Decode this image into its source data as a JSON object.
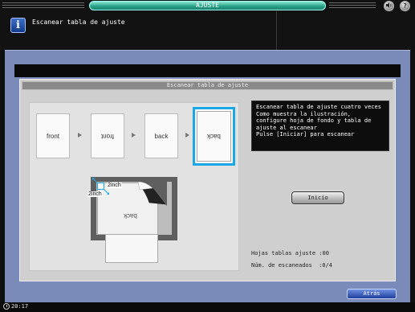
{
  "header": {
    "title": "AJUSTE",
    "speaker_icon": "speaker-icon",
    "help_icon": "help-icon",
    "help_label": "?"
  },
  "message": {
    "icon": "info-icon",
    "icon_label": "i",
    "text": "Escanear tabla de ajuste"
  },
  "panel": {
    "title": "Escanear tabla de ajuste"
  },
  "illustration": {
    "sheets": [
      {
        "label": "front",
        "flipped": false,
        "selected": false
      },
      {
        "label": "front",
        "flipped": true,
        "selected": false
      },
      {
        "label": "back",
        "flipped": false,
        "selected": false
      },
      {
        "label": "back",
        "flipped": true,
        "selected": true
      }
    ],
    "scanner_sheet_label": "back",
    "inch_top": "2inch",
    "inch_left": "2inch"
  },
  "instructions": "Escanear tabla de ajuste cuatro veces\nComo muestra la ilustración,\nconfigure hoja de fondo y tabla de\najuste al escanear\nPulse [Iniciar] para escanear",
  "buttons": {
    "start": "Inicio",
    "back": "Atrás"
  },
  "status": {
    "sheets_label": "Hojas tablas ajuste",
    "sheets_value": ":00",
    "scans_label": "Núm. de escaneados",
    "scans_value": ":0/4"
  },
  "clock": "20:17"
}
